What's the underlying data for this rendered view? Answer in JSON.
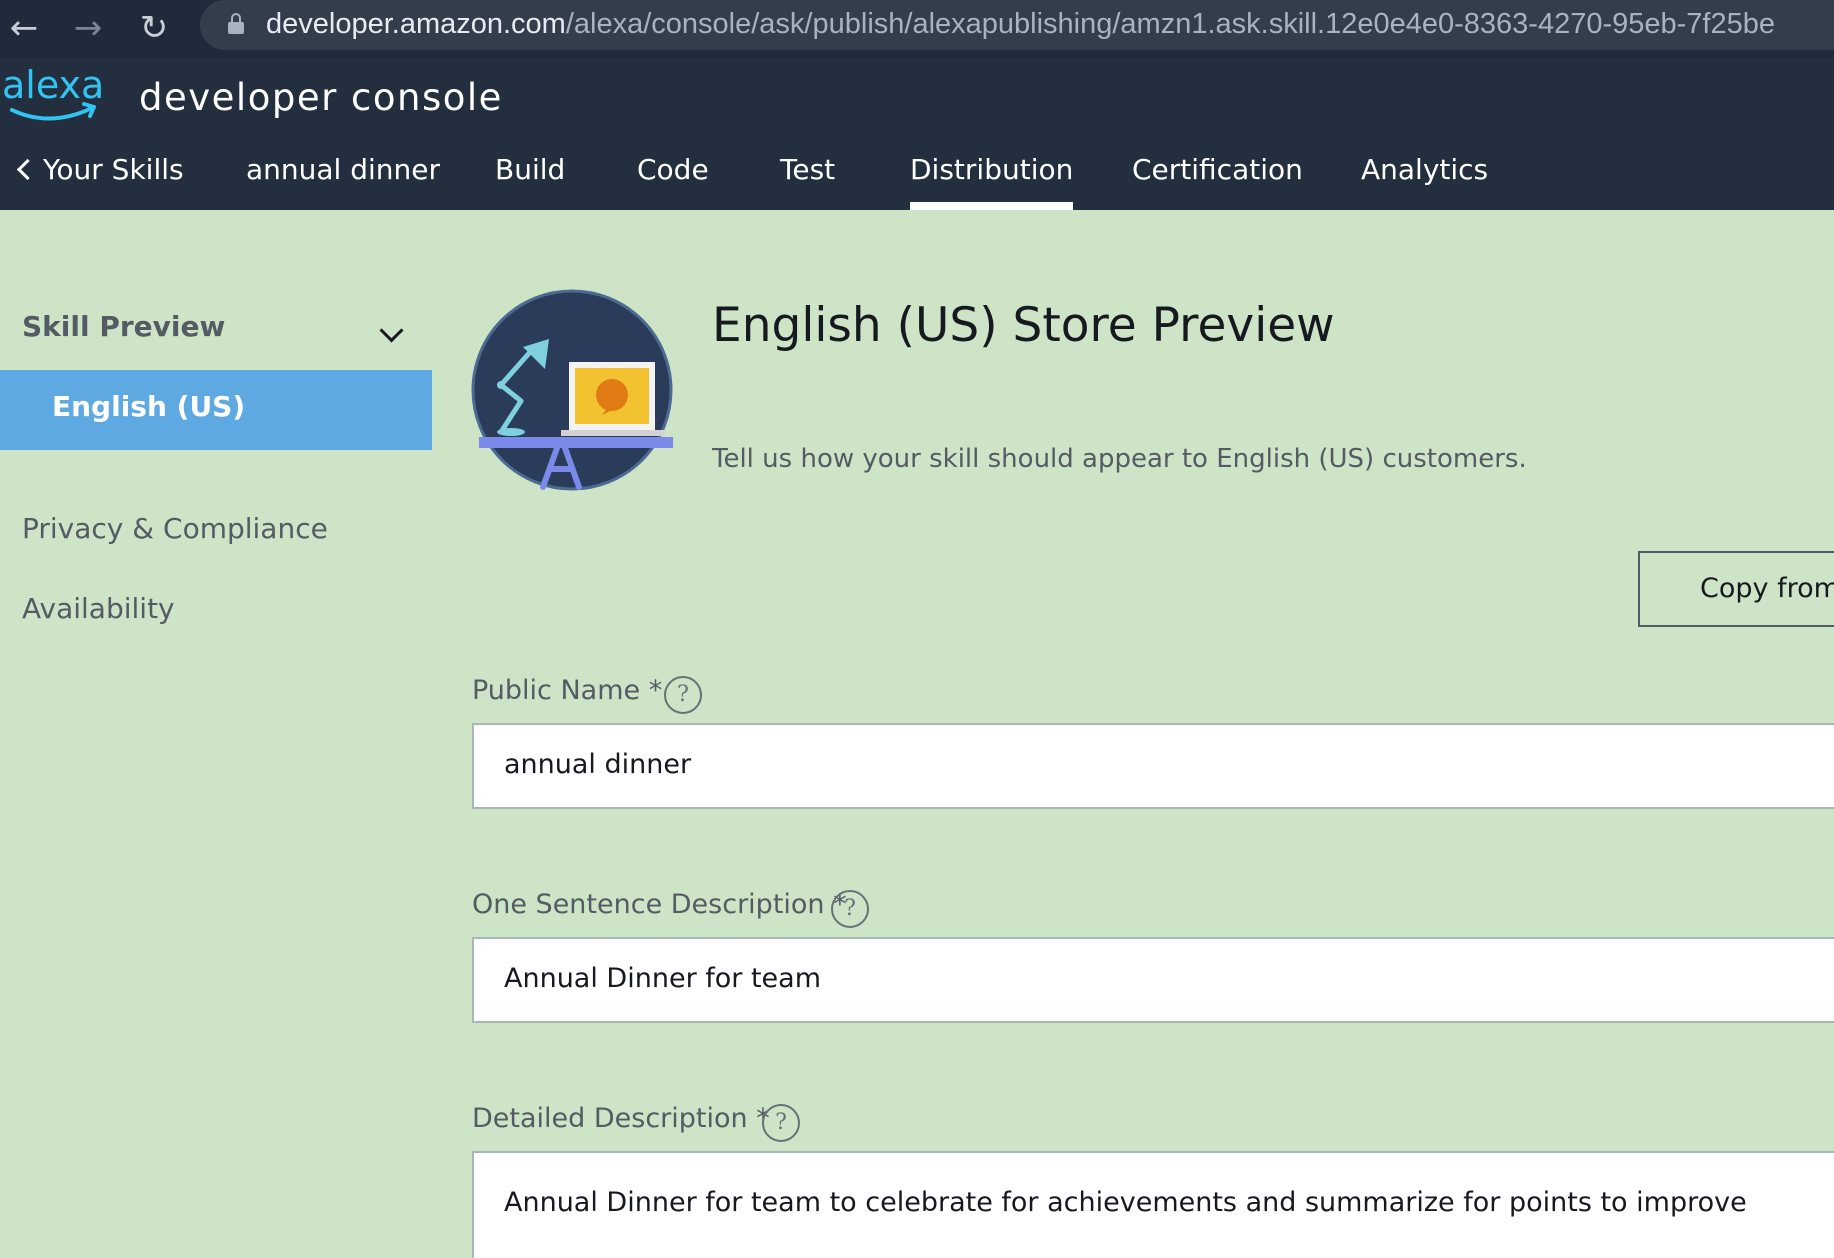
{
  "browser": {
    "url_host": "developer.amazon.com",
    "url_path": "/alexa/console/ask/publish/alexapublishing/amzn1.ask.skill.12e0e4e0-8363-4270-95eb-7f25be"
  },
  "header": {
    "logo_text": "alexa",
    "app_title": "developer console"
  },
  "top_nav": {
    "back_label": "Your Skills",
    "items": [
      {
        "label": "annual dinner"
      },
      {
        "label": "Build"
      },
      {
        "label": "Code"
      },
      {
        "label": "Test"
      },
      {
        "label": "Distribution",
        "active": true
      },
      {
        "label": "Certification"
      },
      {
        "label": "Analytics"
      }
    ]
  },
  "sidebar": {
    "section_title": "Skill Preview",
    "active_item": "English (US)",
    "links": [
      "Privacy & Compliance",
      "Availability"
    ]
  },
  "main": {
    "title": "English (US) Store Preview",
    "subtitle": "Tell us how your skill should appear to English (US) customers.",
    "copy_button_label": "Copy from",
    "fields": [
      {
        "label": "Public Name *",
        "value": "annual dinner"
      },
      {
        "label": "One Sentence Description *",
        "value": "Annual Dinner for team"
      },
      {
        "label": "Detailed Description *",
        "value": "Annual Dinner for team to celebrate for achievements and summarize for points to improve"
      }
    ]
  },
  "colors": {
    "page_background": "#cde5c6",
    "header_background": "#232f3e",
    "sidebar_active": "#5fa9e3",
    "logo_blue": "#31c4f3"
  }
}
